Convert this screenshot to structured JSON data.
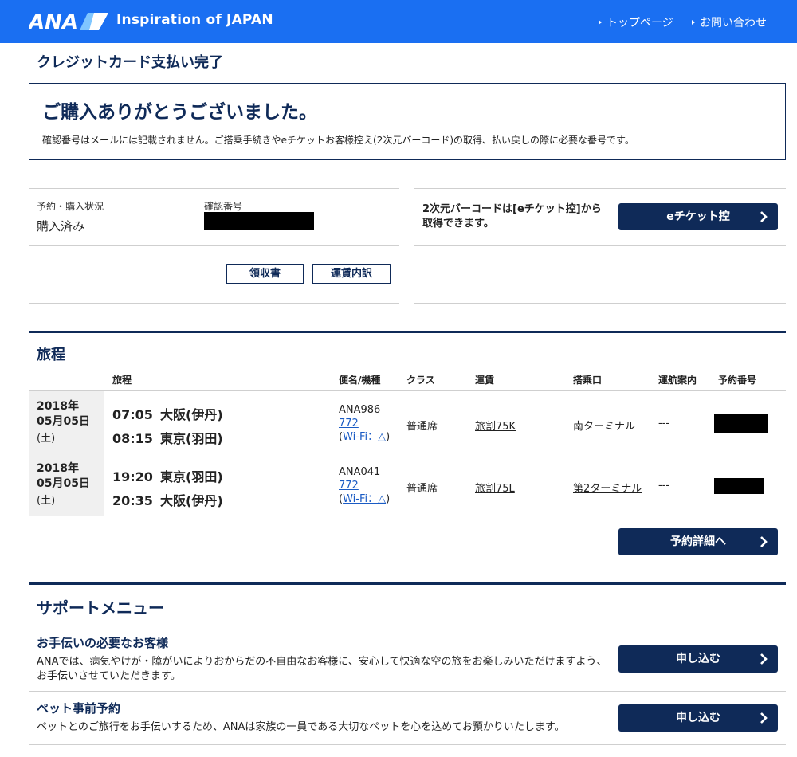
{
  "header": {
    "logo_text": "ANA",
    "tagline": "Inspiration of JAPAN",
    "nav": [
      {
        "label": "トップページ"
      },
      {
        "label": "お問い合わせ"
      }
    ]
  },
  "page_title": "クレジットカード支払い完了",
  "thanks": {
    "heading": "ご購入ありがとうございました。",
    "note": "確認番号はメールには記載されません。ご搭乗手続きやeチケットお客様控え(2次元バーコード)の取得、払い戻しの際に必要な番号です。"
  },
  "status": {
    "status_label": "予約・購入状況",
    "status_value": "購入済み",
    "confirm_label": "確認番号",
    "receipt_button": "領収書",
    "fare_button": "運賃内訳"
  },
  "barcode": {
    "note_line1": "2次元バーコードは[eチケット控]から",
    "note_line2": "取得できます。",
    "eticket_button": "eチケット控"
  },
  "itinerary": {
    "title": "旅程",
    "columns": {
      "route": "旅程",
      "flight": "便名/機種",
      "class": "クラス",
      "fare": "運賃",
      "gate": "搭乗口",
      "ops": "運航案内",
      "booking": "予約番号"
    },
    "rows": [
      {
        "date": "2018年\n05月05日",
        "weekday": "(土)",
        "dep_time": "07:05",
        "dep_airport": "大阪(伊丹)",
        "arr_time": "08:15",
        "arr_airport": "東京(羽田)",
        "flight_no": "ANA986",
        "aircraft": "772",
        "wifi": "Wi-Fi：△",
        "class": "普通席",
        "fare": "旅割75K",
        "gate": "南ターミナル",
        "ops": "---"
      },
      {
        "date": "2018年\n05月05日",
        "weekday": "(土)",
        "dep_time": "19:20",
        "dep_airport": "東京(羽田)",
        "arr_time": "20:35",
        "arr_airport": "大阪(伊丹)",
        "flight_no": "ANA041",
        "aircraft": "772",
        "wifi": "Wi-Fi：△",
        "class": "普通席",
        "fare": "旅割75L",
        "gate": "第2ターミナル",
        "ops": "---"
      }
    ],
    "detail_button": "予約詳細へ"
  },
  "support": {
    "title": "サポートメニュー",
    "items": [
      {
        "heading": "お手伝いの必要なお客様",
        "text": "ANAでは、病気やけが・障がいによりおからだの不自由なお客様に、安心して快適な空の旅をお楽しみいただけますよう、お手伝いさせていただきます。",
        "button": "申し込む"
      },
      {
        "heading": "ペット事前予約",
        "text": "ペットとのご旅行をお手伝いするため、ANAは家族の一員である大切なペットを心を込めてお預かりいたします。",
        "button": "申し込む"
      }
    ]
  },
  "colors": {
    "header_blue": "#1a6ff2",
    "navy": "#0f2a58",
    "link_blue": "#1a5bc4"
  }
}
